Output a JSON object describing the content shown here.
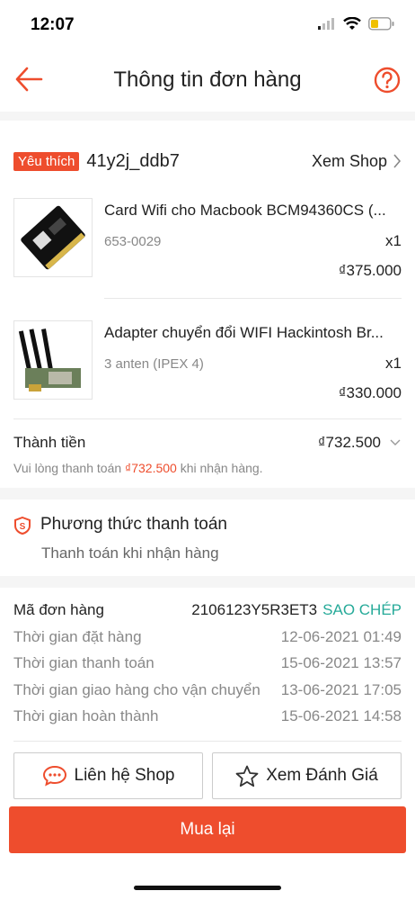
{
  "status_bar": {
    "time": "12:07"
  },
  "header": {
    "title": "Thông tin đơn hàng"
  },
  "shop": {
    "badge": "Yêu thích",
    "name": "41y2j_ddb7",
    "view_label": "Xem Shop"
  },
  "products": [
    {
      "name": "Card Wifi cho Macbook BCM94360CS (...",
      "variant": "653-0029",
      "qty": "x1",
      "price": "₫375.000"
    },
    {
      "name": "Adapter chuyển đổi WIFI Hackintosh Br...",
      "variant": "3 anten (IPEX 4)",
      "qty": "x1",
      "price": "₫330.000"
    }
  ],
  "total": {
    "label": "Thành tiền",
    "value": "₫732.500",
    "note_prefix": "Vui lòng thanh toán ",
    "note_amount": "₫732.500",
    "note_suffix": " khi nhận hàng."
  },
  "payment": {
    "title": "Phương thức thanh toán",
    "method": "Thanh toán khi nhận hàng"
  },
  "order_info": {
    "id_label": "Mã đơn hàng",
    "id_value": "2106123Y5R3ET3",
    "copy_label": "SAO CHÉP",
    "rows": [
      {
        "label": "Thời gian đặt hàng",
        "value": "12-06-2021 01:49"
      },
      {
        "label": "Thời gian thanh toán",
        "value": "15-06-2021 13:57"
      },
      {
        "label": "Thời gian giao hàng cho vận chuyển",
        "value": "13-06-2021 17:05"
      },
      {
        "label": "Thời gian hoàn thành",
        "value": "15-06-2021 14:58"
      }
    ]
  },
  "actions": {
    "contact_shop": "Liên hệ Shop",
    "view_review": "Xem Đánh Giá",
    "buy_again": "Mua lại"
  },
  "colors": {
    "accent": "#ee4d2d",
    "copy": "#26aa99"
  },
  "icons": [
    "back-arrow-icon",
    "help-icon",
    "chevron-right-icon",
    "chevron-down-icon",
    "shield-icon",
    "chat-icon",
    "star-icon"
  ]
}
